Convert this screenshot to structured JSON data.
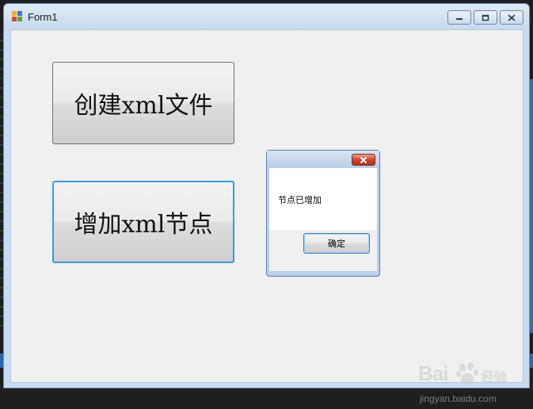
{
  "window": {
    "title": "Form1",
    "controls": {
      "minimize_icon": "minimize-icon",
      "maximize_icon": "maximize-icon",
      "close_icon": "close-icon"
    }
  },
  "form": {
    "create_button_label": "创建xml文件",
    "add_node_button_label": "增加xml节点"
  },
  "message_box": {
    "message": "节点已增加",
    "ok_label": "确定",
    "close_icon": "close-icon"
  },
  "watermark": {
    "logo": "Bai",
    "logo_suffix": "经验",
    "url": "jingyan.baidu.com"
  },
  "colors": {
    "focus_border": "#3c9ad6",
    "dialog_close_red": "#c6402c",
    "client_background": "#f0f0f0"
  }
}
